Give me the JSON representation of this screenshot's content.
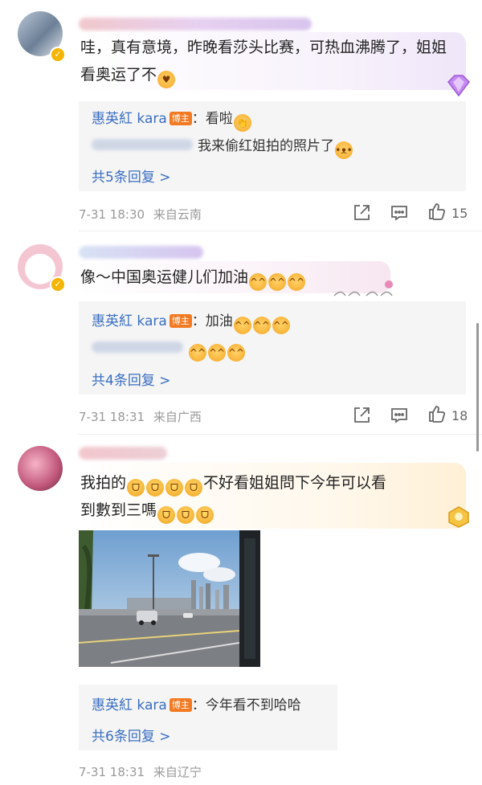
{
  "comments": [
    {
      "text": "哇，真有意境，昨晚看莎头比赛，可热血沸腾了，姐姐看奥运了不",
      "replies": [
        {
          "name": "惠英紅 kara",
          "badge": "博主",
          "text": "：看啦"
        },
        {
          "text": "我来偷红姐拍的照片了"
        }
      ],
      "more": "共5条回复 >",
      "time": "7-31 18:30",
      "location": "来自云南",
      "likes": "15"
    },
    {
      "text": "像～中国奥运健儿们加油",
      "replies": [
        {
          "name": "惠英紅 kara",
          "badge": "博主",
          "text": "：加油"
        }
      ],
      "more": "共4条回复 >",
      "time": "7-31 18:31",
      "location": "来自广西",
      "likes": "18"
    },
    {
      "text_line1": "我拍的",
      "text_line1b": "不好看姐姐問下今年可以看",
      "text_line2": "到數到三嗎",
      "replies": [
        {
          "name": "惠英紅 kara",
          "badge": "博主",
          "text": "：今年看不到哈哈"
        }
      ],
      "more": "共6条回复 >",
      "time": "7-31 18:31",
      "location": "来自辽宁"
    }
  ],
  "icons": {
    "share": "share-icon",
    "comment": "comment-icon",
    "like": "thumbs-up-icon",
    "verified": "verified-badge-icon"
  },
  "colors": {
    "link": "#3a6ec2",
    "host_badge": "#f27a23",
    "reply_bg": "#f5f5f5",
    "meta": "#999999"
  }
}
